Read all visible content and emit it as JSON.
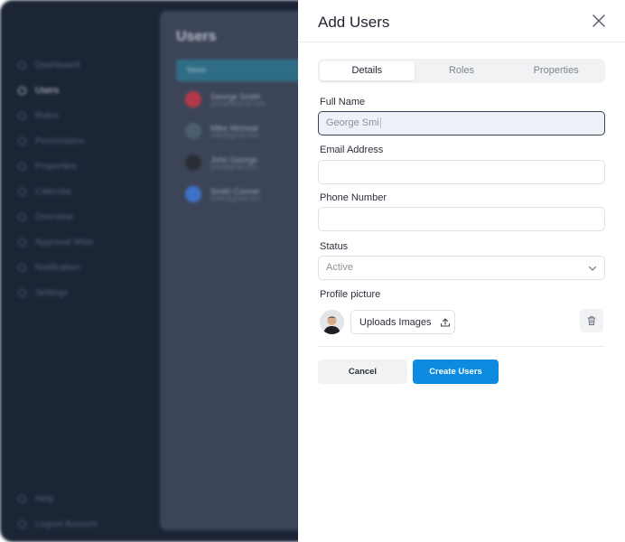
{
  "background": {
    "nav": [
      "Dashboard",
      "Users",
      "Roles",
      "Permissions",
      "Properties",
      "Calendar",
      "Overview",
      "Approval Wise",
      "Notification",
      "Settings"
    ],
    "active_nav": "Users",
    "bottom_nav": [
      "Help",
      "Logout Account"
    ],
    "page_title": "Users",
    "table_header": "Name",
    "rows": [
      {
        "name": "George Smith",
        "email": "george@gmail.com",
        "color": "#b4384a"
      },
      {
        "name": "Mike Micheal",
        "email": "mike@gmail.com",
        "color": "#4a5f6e"
      },
      {
        "name": "John George",
        "email": "john@gmail.com",
        "color": "#2a2d33"
      },
      {
        "name": "Smith Conner",
        "email": "smith@gmail.com",
        "color": "#3e72c9"
      }
    ]
  },
  "drawer": {
    "title": "Add Users",
    "tabs": [
      {
        "label": "Details",
        "active": true
      },
      {
        "label": "Roles",
        "active": false
      },
      {
        "label": "Properties",
        "active": false
      }
    ],
    "full_name": {
      "label": "Full Name",
      "value": "George Smi"
    },
    "email": {
      "label": "Email Address",
      "value": ""
    },
    "phone": {
      "label": "Phone Number",
      "value": ""
    },
    "status": {
      "label": "Status",
      "value": "Active"
    },
    "profile": {
      "label": "Profile picture",
      "upload_label": "Uploads Images"
    },
    "cancel_label": "Cancel",
    "create_label": "Create Users"
  },
  "colors": {
    "accent": "#0d8be0",
    "background_dark": "#1c2536",
    "panel": "#3c4558"
  }
}
